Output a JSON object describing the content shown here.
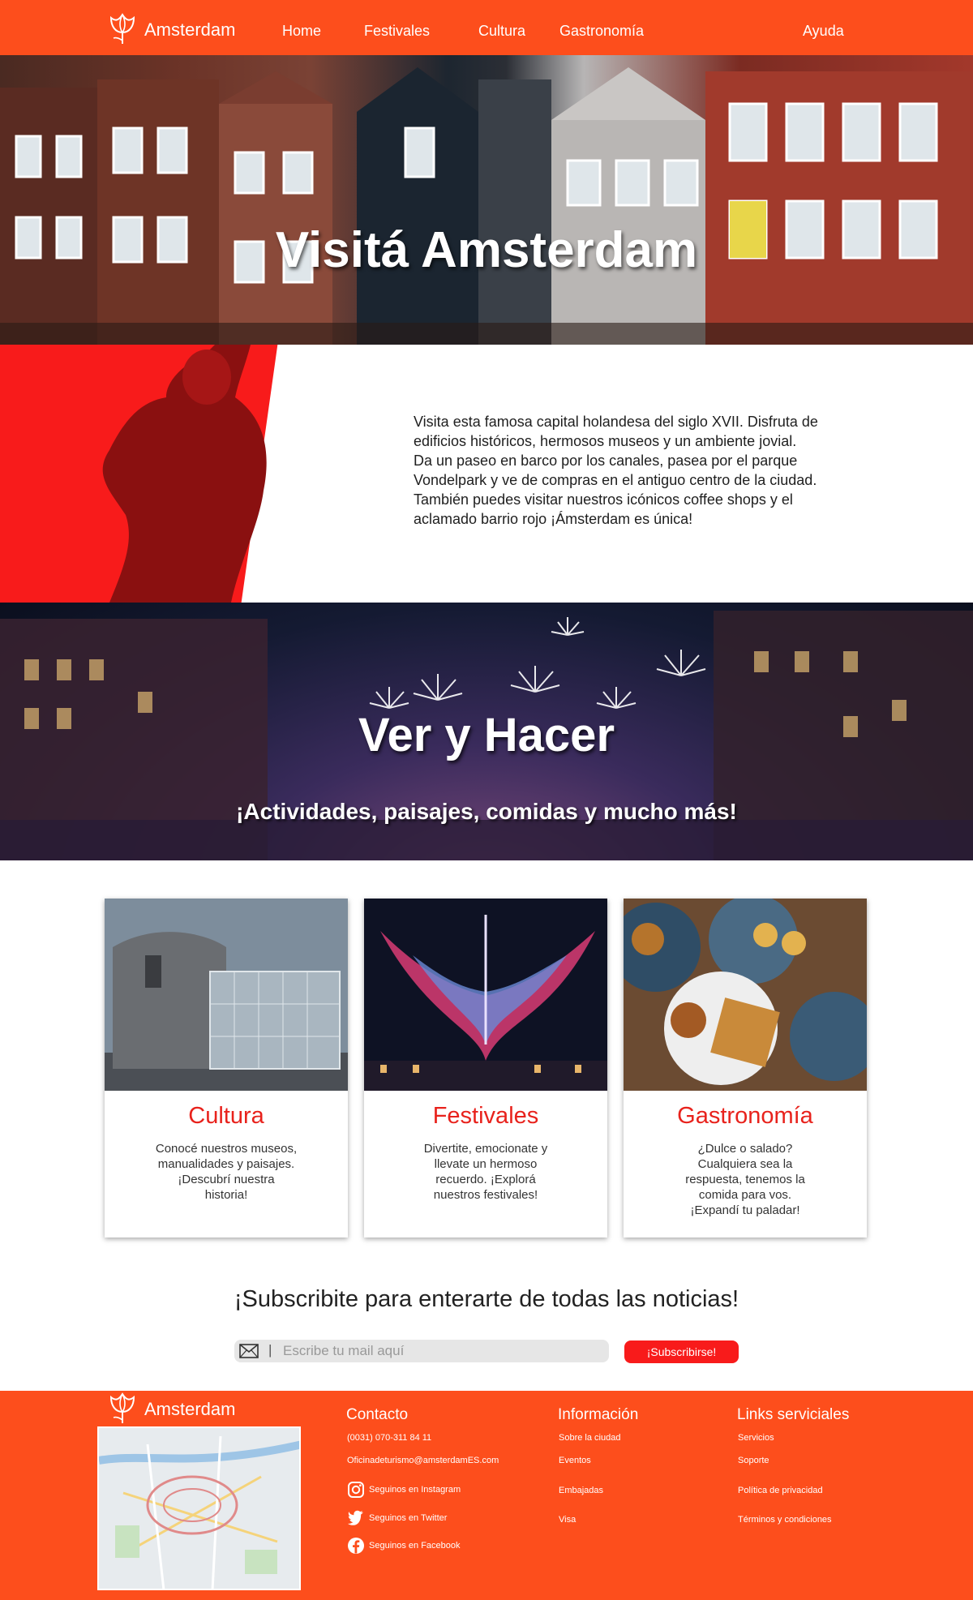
{
  "nav": {
    "brand": "Amsterdam",
    "links": [
      "Home",
      "Festivales",
      "Cultura",
      "Gastronomía"
    ],
    "help": "Ayuda"
  },
  "hero": {
    "title": "Visitá Amsterdam"
  },
  "intro": {
    "text": "Visita esta famosa capital holandesa del siglo XVII. Disfruta de edificios históricos, hermosos museos y un ambiente jovial. Da un paseo en barco por los canales, pasea por el parque Vondelpark y ve de compras en el antiguo centro de la ciudad. También puedes visitar nuestros icónicos coffee shops y el aclamado barrio rojo ¡Ámsterdam es única!"
  },
  "ver_hacer": {
    "title": "Ver y Hacer",
    "subtitle": "¡Actividades, paisajes, comidas y mucho más!"
  },
  "cards": [
    {
      "title": "Cultura",
      "text": "Conocé nuestros museos, manualidades y paisajes. ¡Descubrí nuestra historia!"
    },
    {
      "title": "Festivales",
      "text": "Divertite, emocionate y llevate un hermoso recuerdo. ¡Explorá nuestros festivales!"
    },
    {
      "title": "Gastronomía",
      "text": "¿Dulce o salado? Cualquiera sea la respuesta, tenemos la comida para vos. ¡Expandí tu paladar!"
    }
  ],
  "subscribe": {
    "title": "¡Subscribite para enterarte de todas las noticias!",
    "placeholder": "Escribe tu mail aquí",
    "separator": "|",
    "button": "¡Subscribirse!"
  },
  "footer": {
    "brand": "Amsterdam",
    "contact": {
      "heading": "Contacto",
      "phone": "(0031) 070-311 84 11",
      "email": "Oficinadeturismo@amsterdamES.com",
      "instagram": "Seguinos en Instagram",
      "twitter": "Seguinos en Twitter",
      "facebook": "Seguinos en Facebook"
    },
    "info": {
      "heading": "Información",
      "links": [
        "Sobre la ciudad",
        "Eventos",
        "Embajadas",
        "Visa"
      ]
    },
    "services": {
      "heading": "Links serviciales",
      "links": [
        "Servicios",
        "Soporte",
        "Política de privacidad",
        "Términos y condiciones"
      ]
    }
  },
  "colors": {
    "brand_orange": "#fd4e1c",
    "accent_red": "#f81b1b",
    "card_title": "#e8221c"
  }
}
